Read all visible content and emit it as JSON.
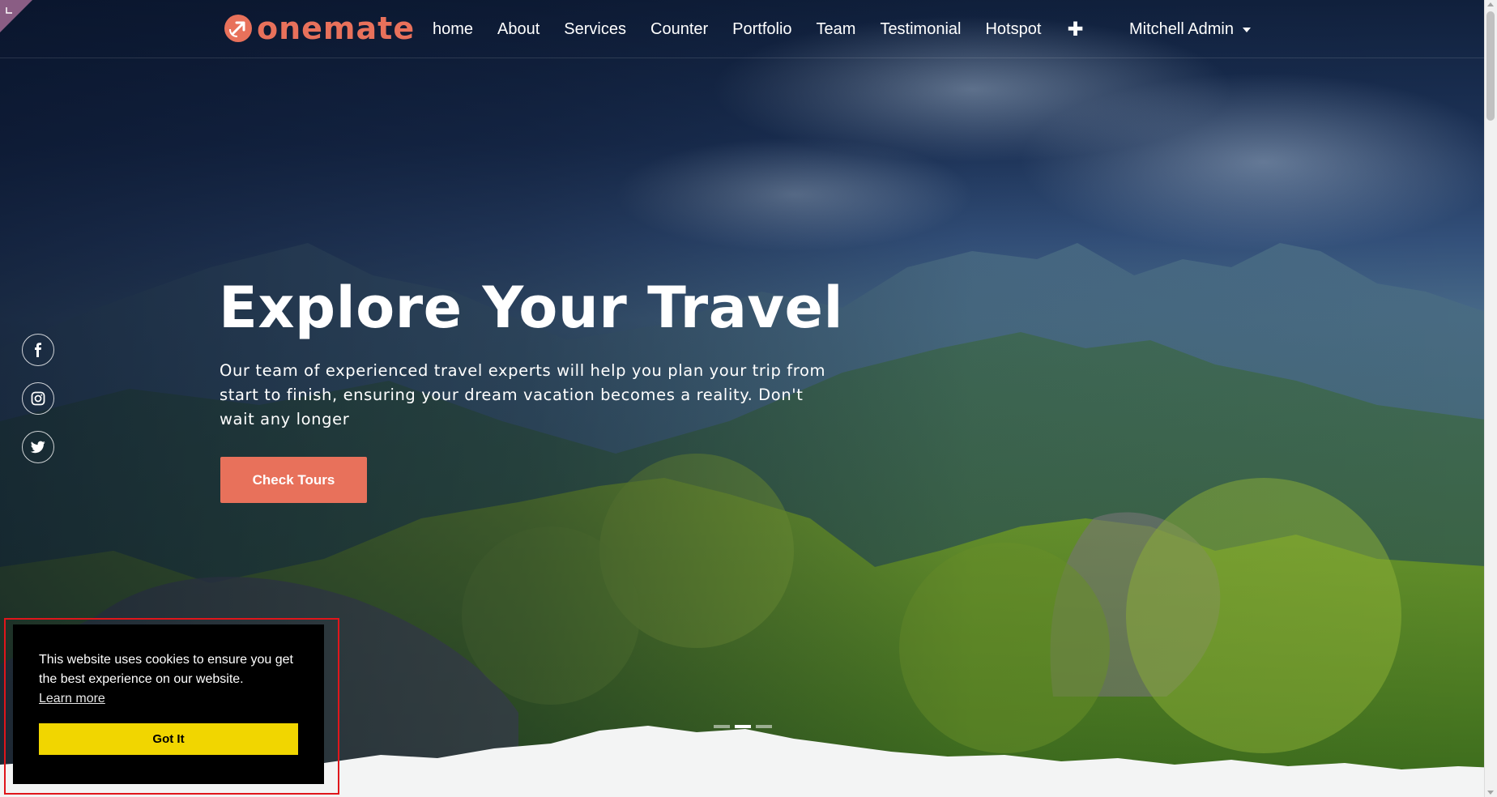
{
  "brand": {
    "name": "onemate",
    "accent": "#e8715b",
    "logo_icon": "arrow-circle-icon"
  },
  "nav": {
    "items": [
      {
        "label": "home"
      },
      {
        "label": "About"
      },
      {
        "label": "Services"
      },
      {
        "label": "Counter"
      },
      {
        "label": "Portfolio"
      },
      {
        "label": "Team"
      },
      {
        "label": "Testimonial"
      },
      {
        "label": "Hotspot"
      }
    ],
    "add_icon": "plus-icon",
    "user": "Mitchell Admin"
  },
  "hero": {
    "title": "Explore Your Travel",
    "text": "Our team of experienced travel experts will help you plan your trip from start to finish, ensuring your dream vacation becomes a reality. Don't wait any longer",
    "cta_label": "Check Tours",
    "slides_total": 3,
    "active_slide": 2
  },
  "social": [
    {
      "name": "facebook-icon"
    },
    {
      "name": "instagram-icon"
    },
    {
      "name": "twitter-icon"
    }
  ],
  "cookie": {
    "message": "This website uses cookies to ensure you get the best experience on our website.",
    "learn_more": "Learn more",
    "button": "Got It",
    "button_color": "#f1d600",
    "background": "#000000"
  }
}
